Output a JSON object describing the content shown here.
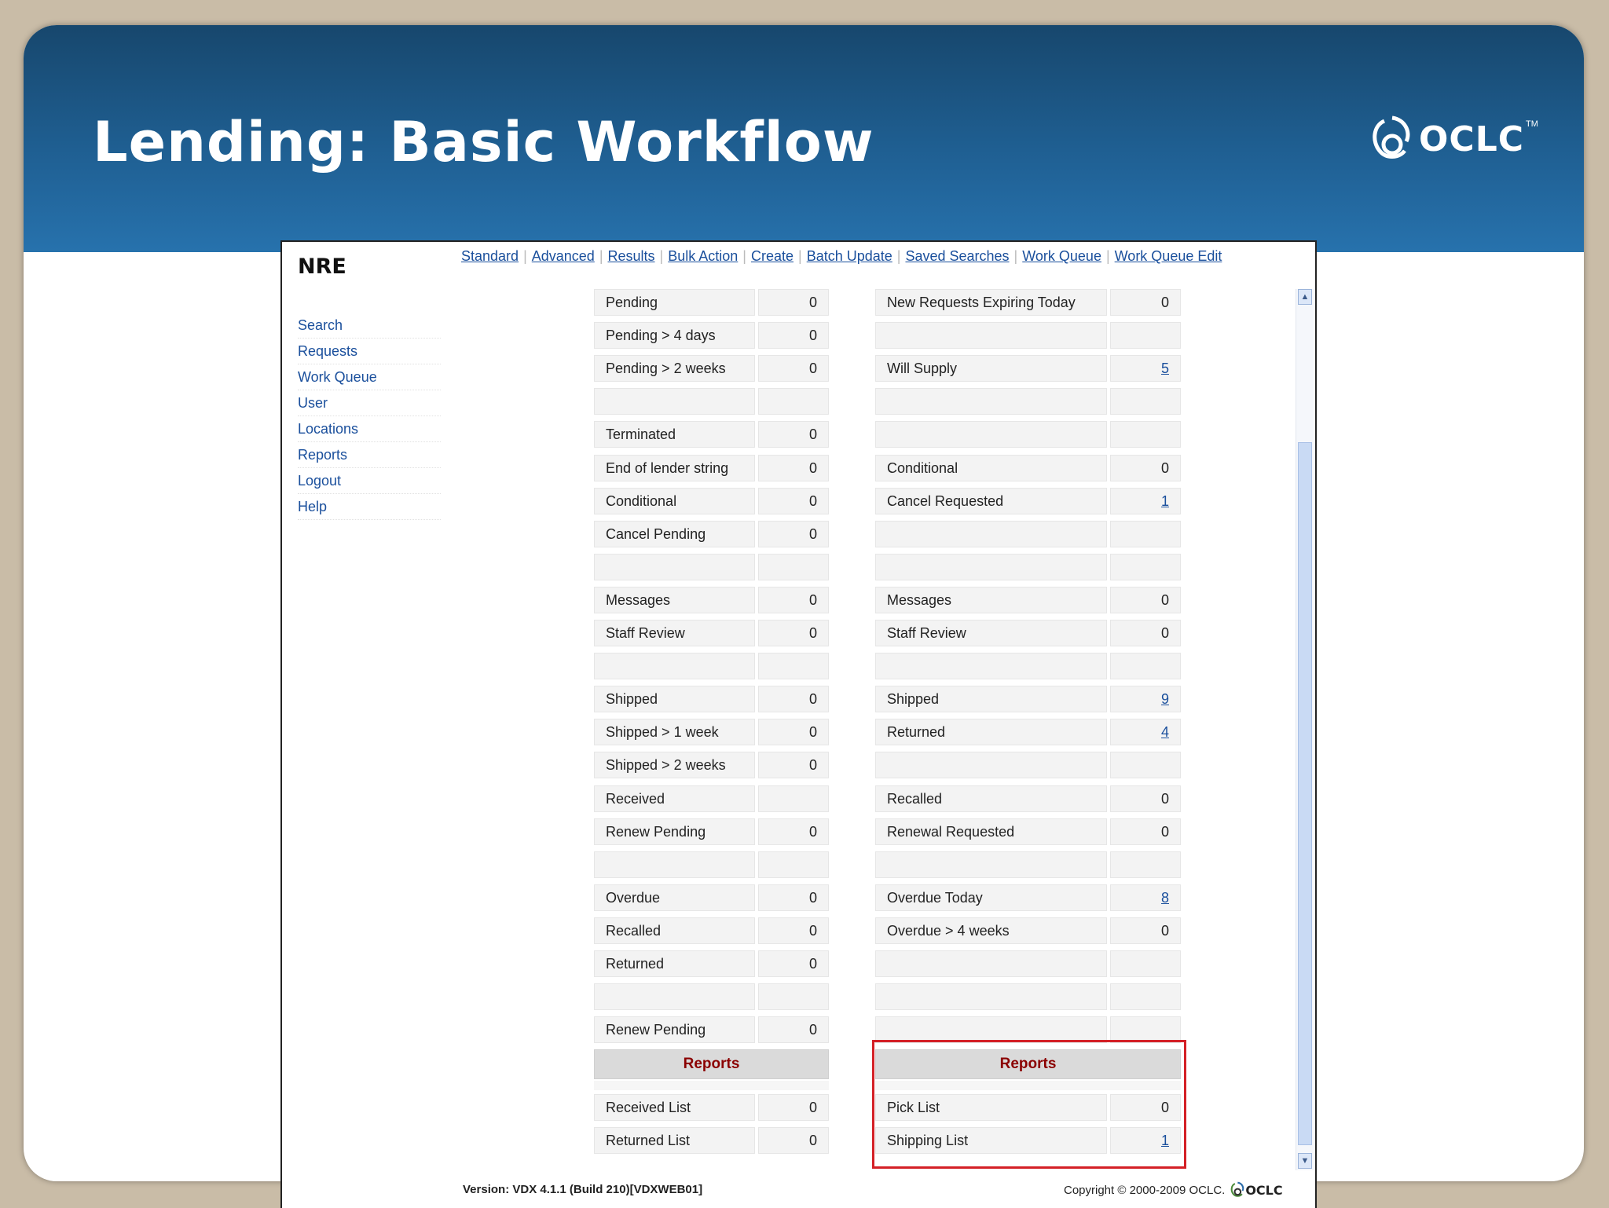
{
  "slide": {
    "title": "Lending: Basic Workflow",
    "logo_text": "OCLC",
    "logo_tm": "TM"
  },
  "app": {
    "brand": "NRE",
    "top_nav": [
      "Standard",
      "Advanced",
      "Results",
      "Bulk Action",
      "Create",
      "Batch Update",
      "Saved Searches",
      "Work Queue",
      "Work Queue Edit"
    ],
    "side_nav": [
      "Search",
      "Requests",
      "Work Queue",
      "User",
      "Locations",
      "Reports",
      "Logout",
      "Help"
    ],
    "left_rows": [
      {
        "label": "Pending",
        "value": "0"
      },
      {
        "label": "Pending > 4 days",
        "value": "0"
      },
      {
        "label": "Pending > 2 weeks",
        "value": "0"
      },
      {
        "label": "",
        "value": ""
      },
      {
        "label": "Terminated",
        "value": "0"
      },
      {
        "label": "End of lender string",
        "value": "0"
      },
      {
        "label": "Conditional",
        "value": "0"
      },
      {
        "label": "Cancel Pending",
        "value": "0"
      },
      {
        "label": "",
        "value": ""
      },
      {
        "label": "Messages",
        "value": "0"
      },
      {
        "label": "Staff Review",
        "value": "0"
      },
      {
        "label": "",
        "value": ""
      },
      {
        "label": "Shipped",
        "value": "0"
      },
      {
        "label": "Shipped > 1 week",
        "value": "0"
      },
      {
        "label": "Shipped > 2 weeks",
        "value": "0"
      },
      {
        "label": "Received",
        "value": ""
      },
      {
        "label": "Renew Pending",
        "value": "0"
      },
      {
        "label": "",
        "value": ""
      },
      {
        "label": "Overdue",
        "value": "0"
      },
      {
        "label": "Recalled",
        "value": "0"
      },
      {
        "label": "Returned",
        "value": "0"
      },
      {
        "label": "",
        "value": ""
      },
      {
        "label": "Renew Pending",
        "value": "0"
      }
    ],
    "right_rows": [
      {
        "label": "New Requests Expiring Today",
        "value": "0"
      },
      {
        "label": "",
        "value": ""
      },
      {
        "label": "Will Supply",
        "value": "5",
        "link": true
      },
      {
        "label": "",
        "value": ""
      },
      {
        "label": "",
        "value": ""
      },
      {
        "label": "Conditional",
        "value": "0"
      },
      {
        "label": "Cancel Requested",
        "value": "1",
        "link": true
      },
      {
        "label": "",
        "value": ""
      },
      {
        "label": "",
        "value": ""
      },
      {
        "label": "Messages",
        "value": "0"
      },
      {
        "label": "Staff Review",
        "value": "0"
      },
      {
        "label": "",
        "value": ""
      },
      {
        "label": "Shipped",
        "value": "9",
        "link": true
      },
      {
        "label": "Returned",
        "value": "4",
        "link": true
      },
      {
        "label": "",
        "value": ""
      },
      {
        "label": "Recalled",
        "value": "0"
      },
      {
        "label": "Renewal Requested",
        "value": "0"
      },
      {
        "label": "",
        "value": ""
      },
      {
        "label": "Overdue Today",
        "value": "8",
        "link": true
      },
      {
        "label": "Overdue > 4 weeks",
        "value": "0"
      },
      {
        "label": "",
        "value": ""
      },
      {
        "label": "",
        "value": ""
      },
      {
        "label": "",
        "value": ""
      }
    ],
    "left_reports": {
      "header": "Reports",
      "rows": [
        {
          "label": "Received List",
          "value": "0"
        },
        {
          "label": "Returned List",
          "value": "0"
        }
      ]
    },
    "right_reports": {
      "header": "Reports",
      "rows": [
        {
          "label": "Pick List",
          "value": "0"
        },
        {
          "label": "Shipping List",
          "value": "1",
          "link": true
        }
      ]
    },
    "footer": {
      "version": "Version: VDX 4.1.1 (Build 210)[VDXWEB01]",
      "copyright": "Copyright © 2000-2009 OCLC.",
      "logo_text": "OCLC"
    }
  },
  "colors": {
    "banner": "#1f5f92",
    "link": "#1a4f9c",
    "report_header_text": "#8b0000",
    "highlight": "#d42026"
  }
}
